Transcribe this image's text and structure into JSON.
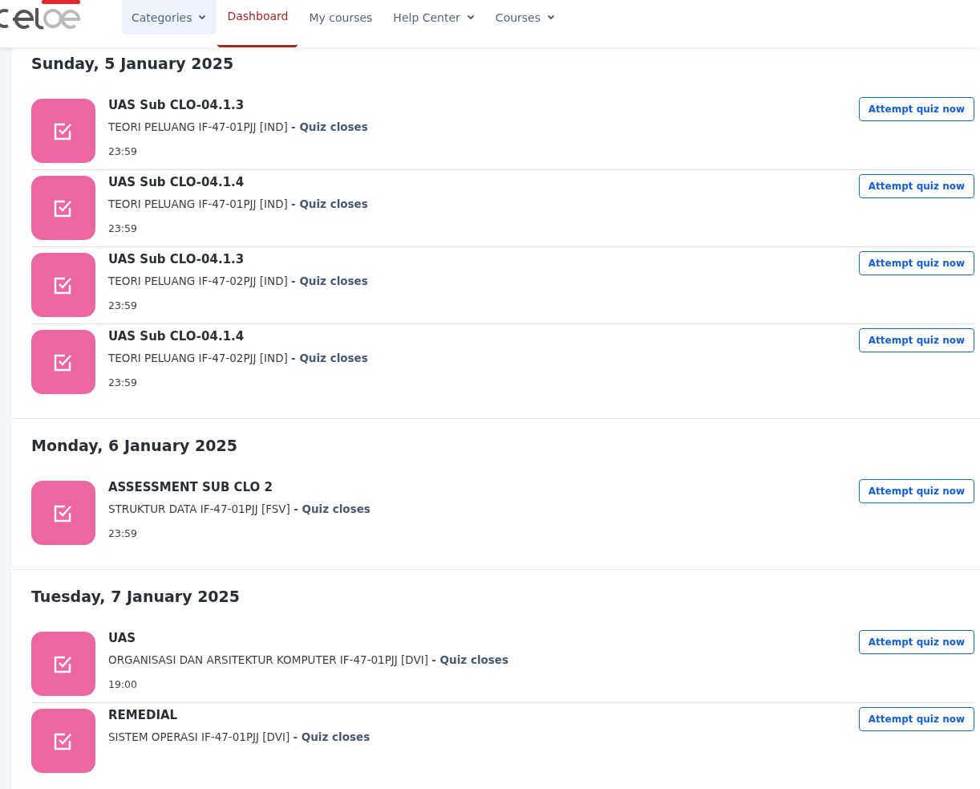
{
  "nav": [
    {
      "label": "Categories",
      "selected": false,
      "highlighted": true,
      "has_menu": true
    },
    {
      "label": "Dashboard",
      "selected": true,
      "highlighted": false,
      "has_menu": false
    },
    {
      "label": "My courses",
      "selected": false,
      "highlighted": false,
      "has_menu": false
    },
    {
      "label": "Help Center",
      "selected": false,
      "highlighted": false,
      "has_menu": true
    },
    {
      "label": "Courses",
      "selected": false,
      "highlighted": false,
      "has_menu": true
    }
  ],
  "days": [
    {
      "date": "Sunday, 5 January 2025",
      "events": [
        {
          "title": "UAS Sub CLO-04.1.3",
          "course": "TEORI PELUANG IF-47-01PJJ [IND]",
          "status": "- Quiz closes",
          "time": "23:59",
          "action": "Attempt quiz now"
        },
        {
          "title": "UAS Sub CLO-04.1.4",
          "course": "TEORI PELUANG IF-47-01PJJ [IND]",
          "status": "- Quiz closes",
          "time": "23:59",
          "action": "Attempt quiz now"
        },
        {
          "title": "UAS Sub CLO-04.1.3",
          "course": "TEORI PELUANG IF-47-02PJJ [IND]",
          "status": "- Quiz closes",
          "time": "23:59",
          "action": "Attempt quiz now"
        },
        {
          "title": "UAS Sub CLO-04.1.4",
          "course": "TEORI PELUANG IF-47-02PJJ [IND]",
          "status": "- Quiz closes",
          "time": "23:59",
          "action": "Attempt quiz now"
        }
      ]
    },
    {
      "date": "Monday, 6 January 2025",
      "events": [
        {
          "title": "ASSESSMENT SUB CLO 2",
          "course": "STRUKTUR DATA IF-47-01PJJ [FSV]",
          "status": "- Quiz closes",
          "time": "23:59",
          "action": "Attempt quiz now"
        }
      ]
    },
    {
      "date": "Tuesday, 7 January 2025",
      "events": [
        {
          "title": "UAS",
          "course": "ORGANISASI DAN ARSITEKTUR KOMPUTER IF-47-01PJJ [DVI]",
          "status": "- Quiz closes",
          "time": "19:00",
          "action": "Attempt quiz now"
        },
        {
          "title": "REMEDIAL",
          "course": "SISTEM OPERASI IF-47-01PJJ [DVI]",
          "status": "- Quiz closes",
          "action": "Attempt quiz now"
        }
      ]
    }
  ]
}
